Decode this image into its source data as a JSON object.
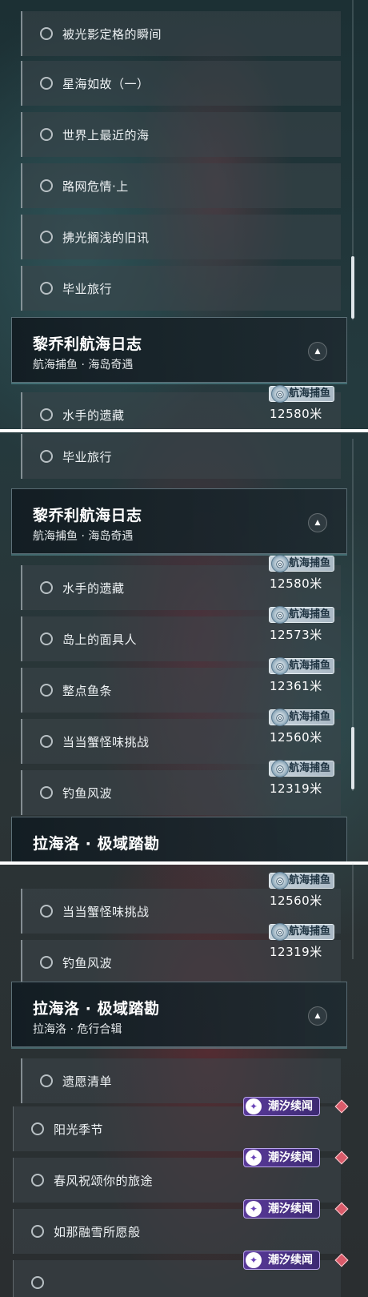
{
  "panels": [
    {
      "items_top": [
        "被光影定格的瞬间",
        "星海如故（一）",
        "世界上最近的海",
        "路网危情·上",
        "拂光搁浅的旧讯",
        "毕业旅行"
      ],
      "section": {
        "title": "黎乔利航海日志",
        "subtitle": "航海捕鱼 · 海岛奇遇"
      },
      "partial_item": {
        "label": "水手的遗藏",
        "tag": "航海捕鱼",
        "distance": "12580米"
      }
    },
    {
      "item_top": "毕业旅行",
      "section": {
        "title": "黎乔利航海日志",
        "subtitle": "航海捕鱼 · 海岛奇遇"
      },
      "quests": [
        {
          "label": "水手的遗藏",
          "tag": "航海捕鱼",
          "distance": "12580米"
        },
        {
          "label": "岛上的面具人",
          "tag": "航海捕鱼",
          "distance": "12573米"
        },
        {
          "label": "整点鱼条",
          "tag": "航海捕鱼",
          "distance": "12361米"
        },
        {
          "label": "当当蟹怪味挑战",
          "tag": "航海捕鱼",
          "distance": "12560米"
        },
        {
          "label": "钓鱼风波",
          "tag": "航海捕鱼",
          "distance": "12319米"
        }
      ],
      "next_section": {
        "title": "拉海洛 · 极域踏勘"
      }
    },
    {
      "quests": [
        {
          "label": "当当蟹怪味挑战",
          "tag": "航海捕鱼",
          "distance": "12560米"
        },
        {
          "label": "钓鱼风波",
          "tag": "航海捕鱼",
          "distance": "12319米"
        }
      ],
      "section": {
        "title": "拉海洛 · 极域踏勘",
        "subtitle": "拉海洛 · 危行合辑"
      },
      "item_first": "遗愿清单",
      "tide_items": [
        {
          "label": "阳光季节",
          "tag": "潮汐续闻"
        },
        {
          "label": "春风祝颂你的旅途",
          "tag": "潮汐续闻"
        },
        {
          "label": "如那融雪所愿般",
          "tag": "潮汐续闻"
        }
      ],
      "partial_tag": "潮汐续闻"
    }
  ],
  "icons": {
    "collapse": "chevron-up-icon",
    "fishing": "fish-badge-icon",
    "tide": "tide-badge-icon",
    "gem": "diamond-icon"
  },
  "colors": {
    "fishing_tag": "#b0c0cc",
    "tide_tag": "#4a3288",
    "gem": "#d95b6a"
  }
}
